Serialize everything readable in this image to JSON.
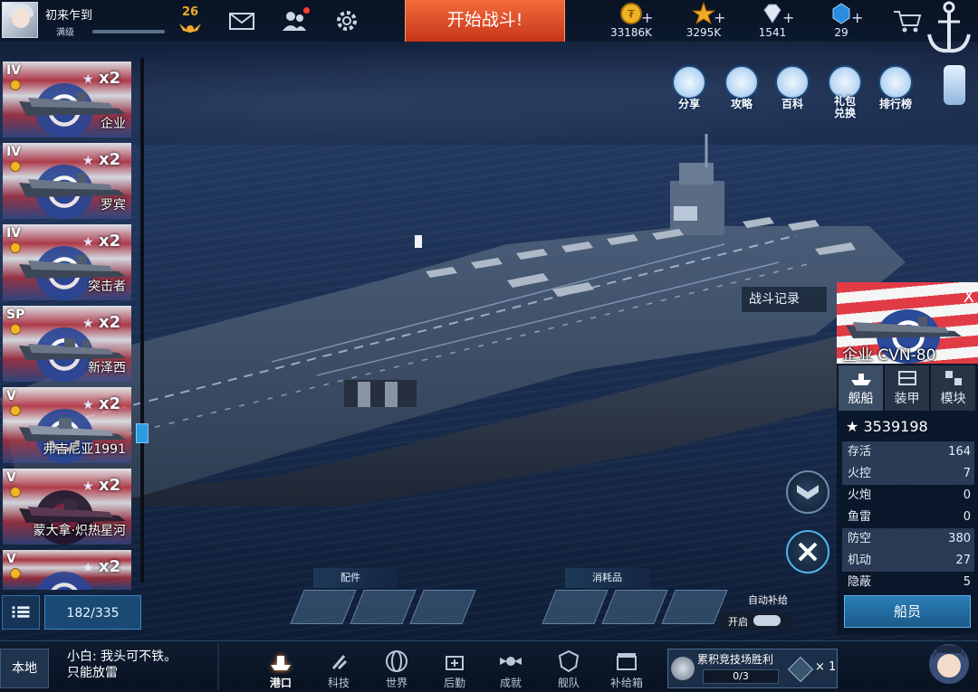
{
  "player": {
    "name": "初来乍到",
    "level_label": "满级",
    "rank_number": "26"
  },
  "top_actions": {
    "battle_label": "开始战斗!"
  },
  "resources": [
    {
      "icon": "gold-coin-icon",
      "value": "33186K"
    },
    {
      "icon": "star-icon",
      "value": "3295K"
    },
    {
      "icon": "diamond-icon",
      "value": "1541"
    },
    {
      "icon": "crystal-icon",
      "value": "29"
    }
  ],
  "functions": [
    {
      "icon": "share-icon",
      "label": "分享"
    },
    {
      "icon": "strategy-icon",
      "label": "攻略"
    },
    {
      "icon": "encyclopedia-icon",
      "label": "百科"
    },
    {
      "icon": "gift-redeem-icon",
      "label": "礼包\n兑换"
    },
    {
      "icon": "leaderboard-icon",
      "label": "排行榜"
    }
  ],
  "ship_list": {
    "count": "182/335",
    "items": [
      {
        "tier": "IV",
        "multiplier": "x2",
        "name": "企业"
      },
      {
        "tier": "IV",
        "multiplier": "x2",
        "name": "罗宾"
      },
      {
        "tier": "IV",
        "multiplier": "x2",
        "name": "突击者"
      },
      {
        "tier": "SP",
        "multiplier": "x2",
        "name": "新泽西"
      },
      {
        "tier": "V",
        "multiplier": "x2",
        "name": "弗吉尼亚1991"
      },
      {
        "tier": "V",
        "multiplier": "x2",
        "name": "蒙大拿·炽热星河"
      },
      {
        "tier": "V",
        "multiplier": "x2",
        "name": ""
      }
    ]
  },
  "battle_log_label": "战斗记录",
  "ship_panel": {
    "close_label": "X",
    "title": "企业 CVN-80",
    "tabs": [
      {
        "label": "舰船"
      },
      {
        "label": "装甲"
      },
      {
        "label": "模块"
      }
    ],
    "power": "3539198",
    "stats": [
      {
        "label": "存活",
        "value": "164"
      },
      {
        "label": "火控",
        "value": "7"
      },
      {
        "label": "火炮",
        "value": "0"
      },
      {
        "label": "鱼雷",
        "value": "0"
      },
      {
        "label": "防空",
        "value": "380"
      },
      {
        "label": "机动",
        "value": "27"
      },
      {
        "label": "隐蔽",
        "value": "5"
      }
    ],
    "crew_label": "船员"
  },
  "equipment": {
    "parts_label": "配件",
    "consumables_label": "消耗品",
    "auto_supply_label": "自动补给",
    "toggle_label": "开启"
  },
  "bottom": {
    "local_label": "本地",
    "chat": "小白: 我头可不铁。\n只能放雷",
    "nav": [
      {
        "label": "港口",
        "active": true
      },
      {
        "label": "科技"
      },
      {
        "label": "世界"
      },
      {
        "label": "后勤"
      },
      {
        "label": "成就"
      },
      {
        "label": "舰队"
      },
      {
        "label": "补给箱"
      }
    ],
    "arena": {
      "title": "累积竞技场胜利",
      "progress": "0/3",
      "reward_count": "× 1"
    }
  },
  "colors": {
    "battle_button": "#e0522a",
    "accent": "#2d9be0",
    "bottom_bar": "#0e1c30"
  }
}
